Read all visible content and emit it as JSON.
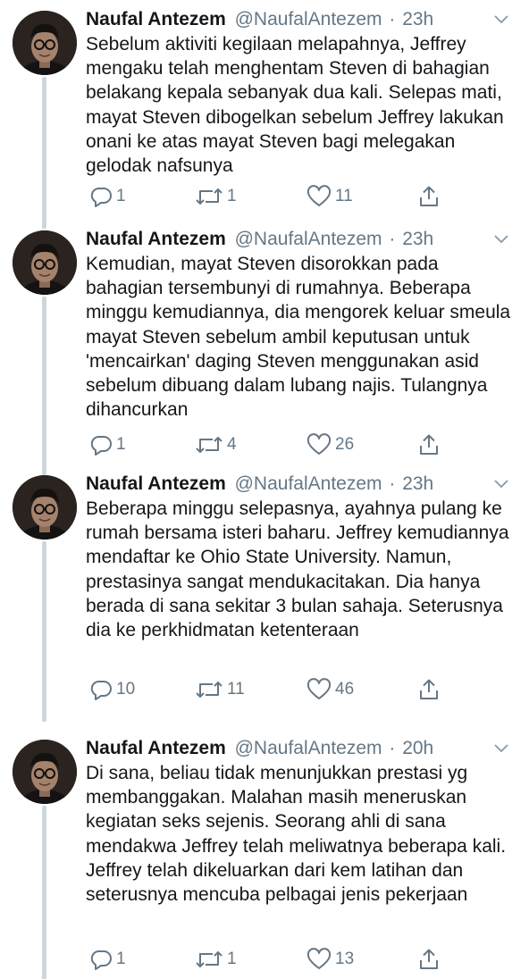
{
  "colors": {
    "text": "#14171a",
    "secondary": "#657786",
    "thread_line": "#ccd6dd"
  },
  "icons": {
    "reply": "reply-icon",
    "retweet": "retweet-icon",
    "like": "heart-icon",
    "share": "share-icon",
    "menu": "chevron-down-icon"
  },
  "tweets": [
    {
      "name": "Naufal Antezem",
      "handle": "@NaufalAntezem",
      "separator": "·",
      "time": "23h",
      "text": "Sebelum aktiviti kegilaan melapahnya, Jeffrey mengaku telah menghentam Steven di bahagian belakang kepala sebanyak dua kali. Selepas mati, mayat Steven dibogelkan sebelum Jeffrey lakukan onani ke atas mayat Steven bagi melegakan gelodak nafsunya",
      "replies": "1",
      "retweets": "1",
      "likes": "11"
    },
    {
      "name": "Naufal Antezem",
      "handle": "@NaufalAntezem",
      "separator": "·",
      "time": "23h",
      "text": "Kemudian, mayat Steven disorokkan pada bahagian tersembunyi di rumahnya. Beberapa minggu kemudiannya, dia mengorek keluar smeula mayat Steven sebelum ambil keputusan untuk 'mencairkan' daging Steven menggunakan asid sebelum dibuang dalam lubang najis. Tulangnya dihancurkan",
      "replies": "1",
      "retweets": "4",
      "likes": "26"
    },
    {
      "name": "Naufal Antezem",
      "handle": "@NaufalAntezem",
      "separator": "·",
      "time": "23h",
      "text": "Beberapa minggu selepasnya, ayahnya pulang ke rumah bersama isteri baharu. Jeffrey kemudiannya mendaftar ke Ohio State University. Namun, prestasinya sangat mendukacitakan. Dia hanya berada di sana sekitar 3 bulan sahaja. Seterusnya dia ke perkhidmatan ketenteraan",
      "replies": "10",
      "retweets": "11",
      "likes": "46"
    },
    {
      "name": "Naufal Antezem",
      "handle": "@NaufalAntezem",
      "separator": "·",
      "time": "20h",
      "text": "Di sana, beliau tidak menunjukkan prestasi yg membanggakan. Malahan masih meneruskan kegiatan seks sejenis. Seorang ahli di sana mendakwa Jeffrey telah meliwatnya beberapa kali. Jeffrey telah dikeluarkan dari kem latihan dan seterusnya mencuba pelbagai jenis pekerjaan",
      "replies": "1",
      "retweets": "1",
      "likes": "13"
    }
  ]
}
